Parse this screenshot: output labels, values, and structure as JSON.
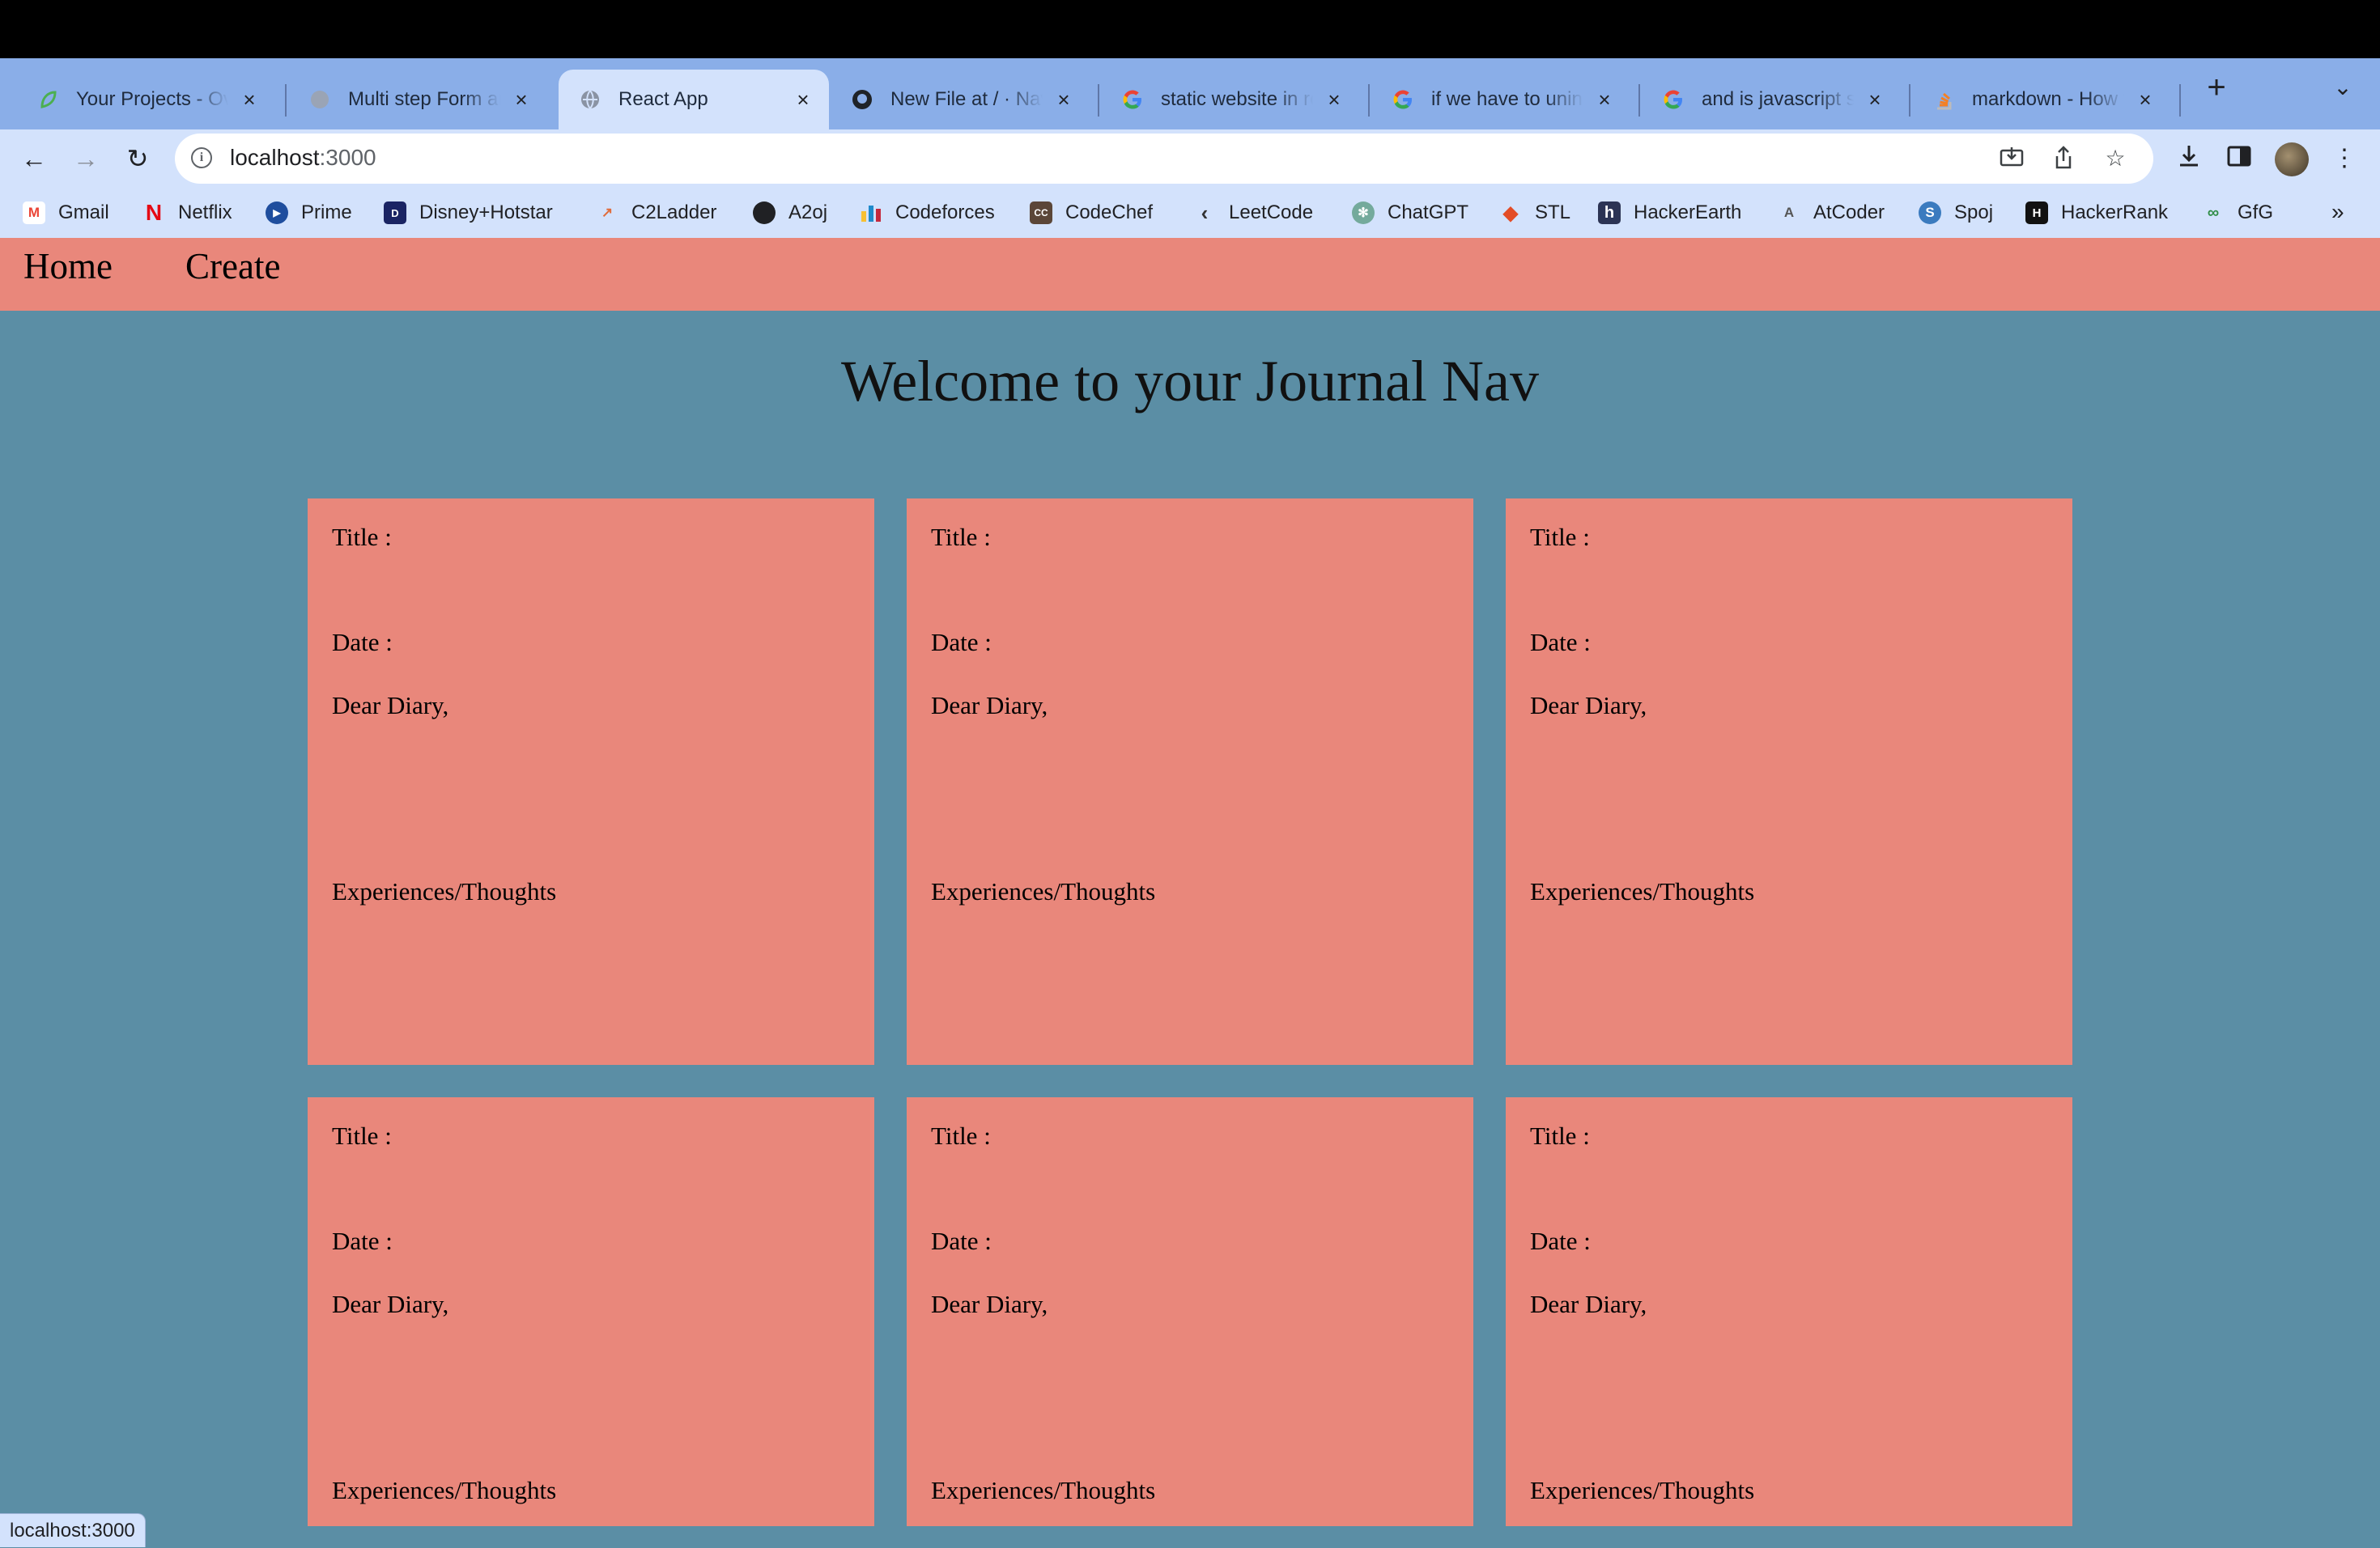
{
  "browser": {
    "tabs": [
      {
        "title": "Your Projects - Overview",
        "icon": "leaf-icon"
      },
      {
        "title": "Multi step Form and",
        "icon": "globe-icon"
      },
      {
        "title": "React App",
        "icon": "globe-icon",
        "active": true
      },
      {
        "title": "New File at / · Nav",
        "icon": "github-icon"
      },
      {
        "title": "static website in react",
        "icon": "google-icon"
      },
      {
        "title": "if we have to uninstall",
        "icon": "google-icon"
      },
      {
        "title": "and is javascript s",
        "icon": "google-icon"
      },
      {
        "title": "markdown - How to",
        "icon": "stackoverflow-icon"
      }
    ],
    "new_tab_label": "+",
    "url_host": "localhost",
    "url_port": ":3000",
    "bookmarks": [
      {
        "label": "Gmail",
        "icon": "gmail-icon",
        "color": "#ea4335",
        "glyph": "M"
      },
      {
        "label": "Netflix",
        "icon": "netflix-icon",
        "color": "#e50914",
        "glyph": "N"
      },
      {
        "label": "Prime",
        "icon": "prime-icon",
        "color": "#1f4e9e",
        "glyph": "▶"
      },
      {
        "label": "Disney+Hotstar",
        "icon": "hotstar-icon",
        "color": "#1a2463",
        "glyph": "D"
      },
      {
        "label": "C2Ladder",
        "icon": "c2ladder-icon",
        "color": "#e06c3c",
        "glyph": "↗"
      },
      {
        "label": "A2oj",
        "icon": "a2oj-icon",
        "color": "#202124",
        "glyph": "●"
      },
      {
        "label": "Codeforces",
        "icon": "codeforces-icon",
        "color": "#1f8acb",
        "glyph": "▮"
      },
      {
        "label": "CodeChef",
        "icon": "codechef-icon",
        "color": "#5b4638",
        "glyph": "CC"
      },
      {
        "label": "LeetCode",
        "icon": "leetcode-icon",
        "color": "#f89f1b",
        "glyph": "‹"
      },
      {
        "label": "ChatGPT",
        "icon": "chatgpt-icon",
        "color": "#74aa9c",
        "glyph": "✻"
      },
      {
        "label": "STL",
        "icon": "stl-icon",
        "color": "#e34c26",
        "glyph": "◆"
      },
      {
        "label": "HackerEarth",
        "icon": "hackerearth-icon",
        "color": "#2c3454",
        "glyph": "h"
      },
      {
        "label": "AtCoder",
        "icon": "atcoder-icon",
        "color": "#555555",
        "glyph": "A"
      },
      {
        "label": "Spoj",
        "icon": "spoj-icon",
        "color": "#3b7bbf",
        "glyph": "S"
      },
      {
        "label": "HackerRank",
        "icon": "hackerrank-icon",
        "color": "#111111",
        "glyph": "H"
      },
      {
        "label": "GfG",
        "icon": "gfg-icon",
        "color": "#2f8d46",
        "glyph": "G"
      }
    ],
    "status_url": "localhost:3000"
  },
  "app": {
    "nav": {
      "home": "Home",
      "create": "Create"
    },
    "heading": "Welcome to your Journal Nav",
    "cards": [
      {
        "title_label": "Title :",
        "date_label": "Date :",
        "greeting": "Dear Diary,",
        "body_label": "Experiences/Thoughts"
      },
      {
        "title_label": "Title :",
        "date_label": "Date :",
        "greeting": "Dear Diary,",
        "body_label": "Experiences/Thoughts"
      },
      {
        "title_label": "Title :",
        "date_label": "Date :",
        "greeting": "Dear Diary,",
        "body_label": "Experiences/Thoughts"
      },
      {
        "title_label": "Title :",
        "date_label": "Date :",
        "greeting": "Dear Diary,",
        "body_label": "Experiences/Thoughts"
      },
      {
        "title_label": "Title :",
        "date_label": "Date :",
        "greeting": "Dear Diary,",
        "body_label": "Experiences/Thoughts"
      },
      {
        "title_label": "Title :",
        "date_label": "Date :",
        "greeting": "Dear Diary,",
        "body_label": "Experiences/Thoughts"
      }
    ]
  },
  "colors": {
    "page_bg": "#5b8ea5",
    "card_bg": "#e9877b",
    "nav_bg": "#e9877b",
    "tabstrip_bg": "#8aaee8",
    "toolbar_bg": "#d3e2fc"
  }
}
